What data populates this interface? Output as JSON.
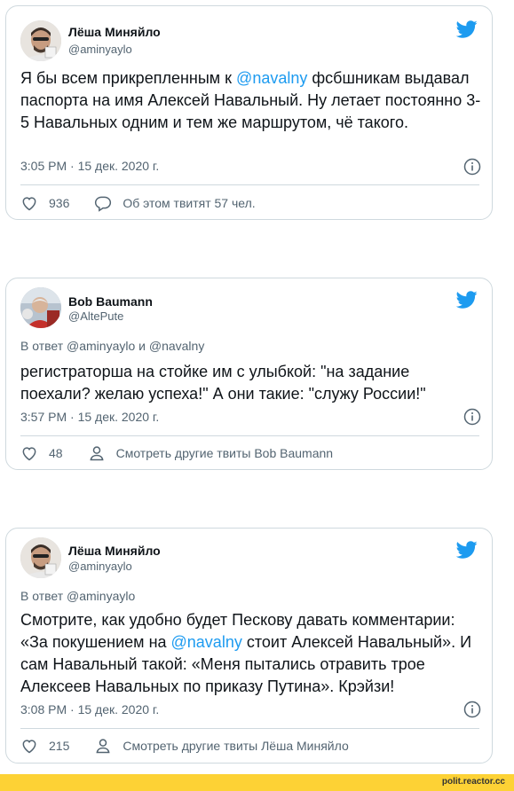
{
  "tweets": [
    {
      "name": "Лёша Миняйло",
      "handle": "@aminyaylo",
      "reply_to": "",
      "text_parts": [
        "Я бы всем прикрепленным к ",
        "@navalny",
        " фсбшникам выдавал паспорта на имя Алексей Навальный. Ну летает постоянно 3-5 Навальных одним и тем же маршрутом, чё такого."
      ],
      "time": "3:05 PM · 15 дек. 2020 г.",
      "likes": "936",
      "secondary_action": "Об этом твитят 57 чел."
    },
    {
      "name": "Bob Baumann",
      "handle": "@AltePute",
      "reply_to": "В ответ @aminyaylo и @navalny",
      "text": "регистраторша на стойке им с улыбкой: \"на задание поехали? желаю успеха!\" А они такие: \"служу России!\"",
      "time": "3:57 PM · 15 дек. 2020 г.",
      "likes": "48",
      "secondary_action": "Смотреть другие твиты Bob Baumann"
    },
    {
      "name": "Лёша Миняйло",
      "handle": "@aminyaylo",
      "reply_to": "В ответ @aminyaylo",
      "text_parts": [
        "Смотрите, как удобно будет Пескову давать комментарии: «За покушением на ",
        "@navalny",
        " стоит Алексей Навальный». И сам Навальный такой: «Меня пытались отравить трое Алексеев Навальных по приказу Путина». Крэйзи!"
      ],
      "time": "3:08 PM · 15 дек. 2020 г.",
      "likes": "215",
      "secondary_action": "Смотреть другие твиты Лёша Миняйло"
    }
  ],
  "icons": {
    "brand": "twitter-bird-icon",
    "like": "heart-icon",
    "comment": "speech-bubble-icon",
    "profile": "person-icon",
    "info": "info-icon"
  },
  "colors": {
    "accent": "#1d9bf0",
    "footer": "#fdd235"
  },
  "footer": {
    "watermark": "polit.reactor.cc"
  }
}
